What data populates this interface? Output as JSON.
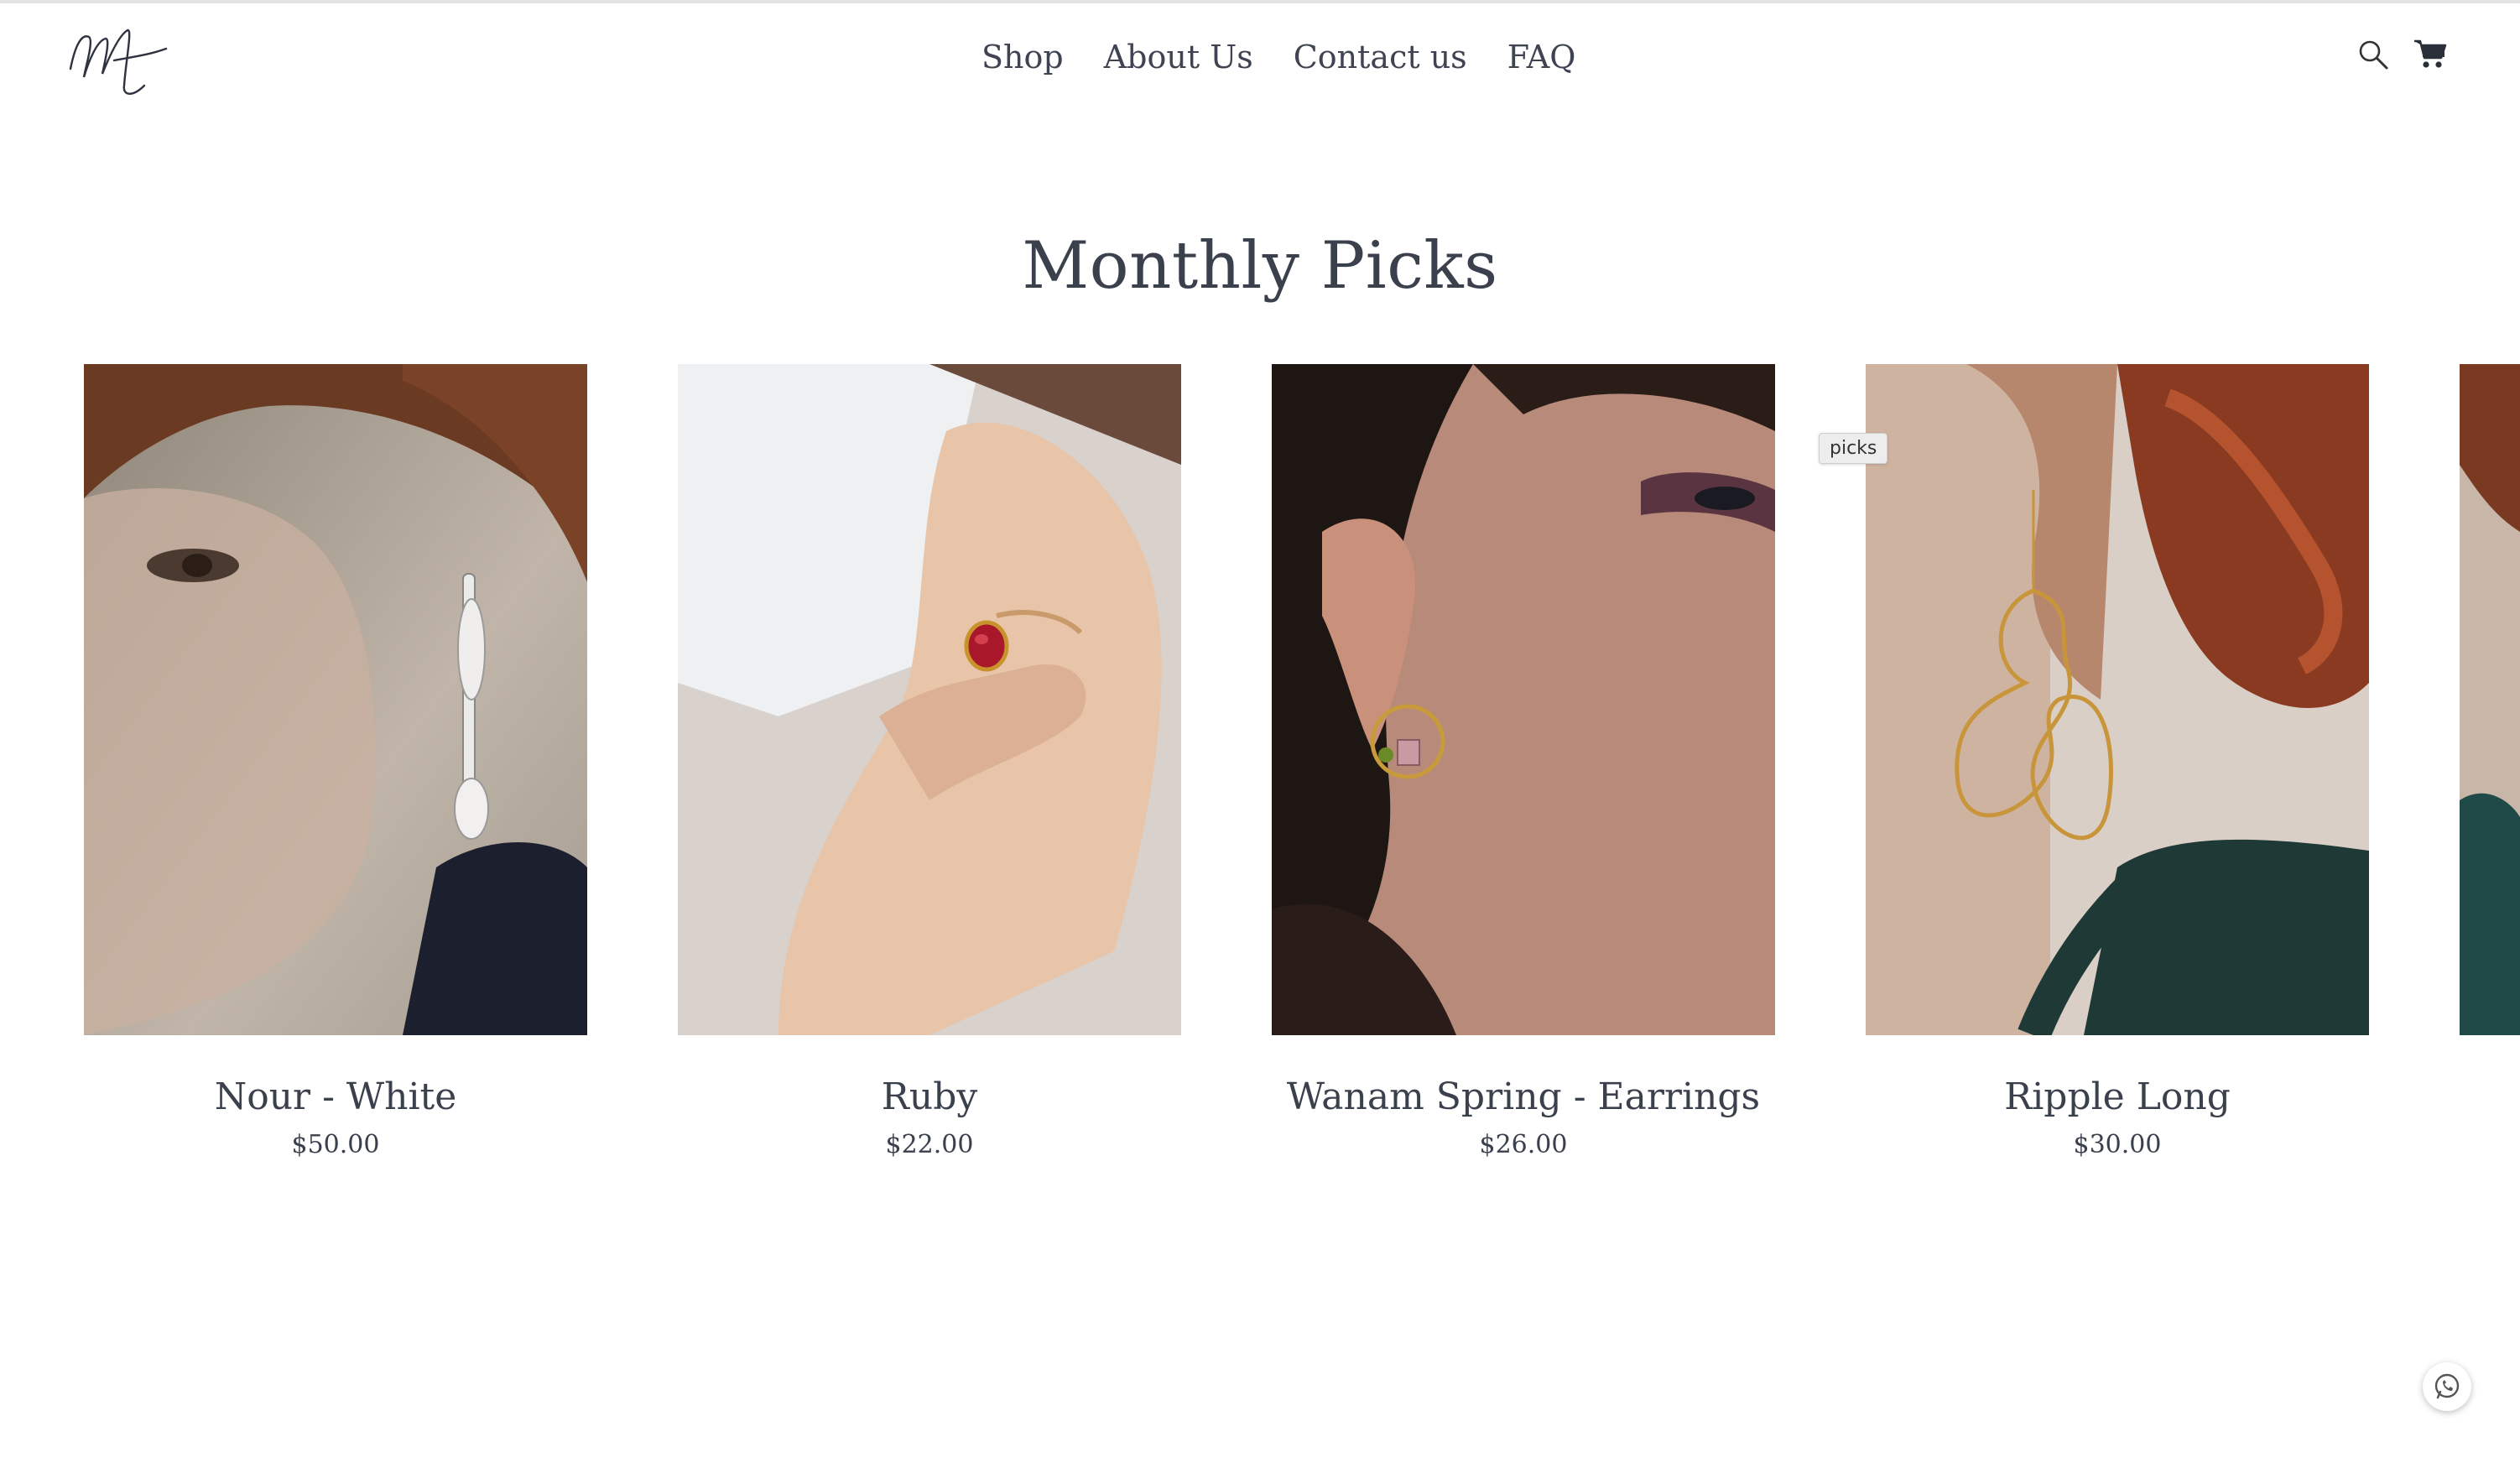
{
  "header": {
    "logo_text": "MA",
    "nav": [
      {
        "label": "Shop"
      },
      {
        "label": "About Us"
      },
      {
        "label": "Contact us"
      },
      {
        "label": "FAQ"
      }
    ],
    "icons": [
      "search-icon",
      "cart-icon"
    ]
  },
  "main": {
    "title": "Monthly Picks",
    "tooltip": "picks",
    "products": [
      {
        "name": "Nour - White",
        "price": "$50.00"
      },
      {
        "name": "Ruby",
        "price": "$22.00"
      },
      {
        "name": "Wanam Spring - Earrings",
        "price": "$26.00"
      },
      {
        "name": "Ripple Long",
        "price": "$30.00"
      }
    ]
  },
  "floating": {
    "icon": "whatsapp-icon"
  },
  "colors": {
    "text": "#3b404d",
    "background": "#ffffff"
  }
}
